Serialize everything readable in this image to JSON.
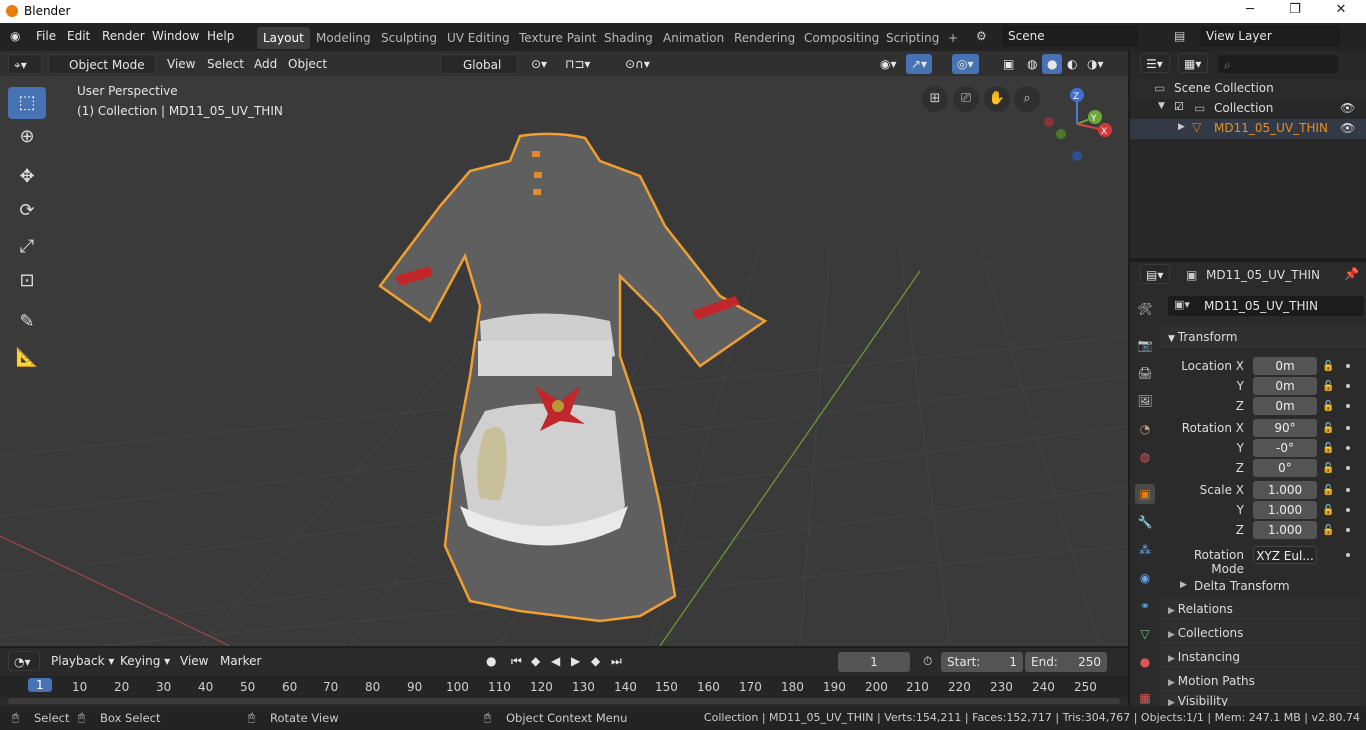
{
  "window": {
    "title": "Blender",
    "minimize": "─",
    "maximize": "❐",
    "close": "✕"
  },
  "menu": [
    "File",
    "Edit",
    "Render",
    "Window",
    "Help"
  ],
  "workspaces": [
    "Layout",
    "Modeling",
    "Sculpting",
    "UV Editing",
    "Texture Paint",
    "Shading",
    "Animation",
    "Rendering",
    "Compositing",
    "Scripting"
  ],
  "add_workspace": "+",
  "scene": "Scene",
  "view_layer": "View Layer",
  "viewport_header": {
    "mode": "Object Mode",
    "view": "View",
    "select": "Select",
    "add": "Add",
    "object": "Object",
    "orientation": "Global"
  },
  "viewport": {
    "perspective": "User Perspective",
    "collection_info": "(1) Collection | MD11_05_UV_THIN",
    "gizmo": {
      "z": "Z",
      "y": "Y",
      "x": "X"
    }
  },
  "outliner": {
    "scene_collection": "Scene Collection",
    "collection": "Collection",
    "object": "MD11_05_UV_THIN",
    "search_placeholder": ""
  },
  "properties": {
    "object_name": "MD11_05_UV_THIN",
    "datablock": "MD11_05_UV_THIN",
    "transform_title": "Transform",
    "location": {
      "label": "Location X",
      "x": "0m",
      "y": "0m",
      "z": "0m"
    },
    "rotation": {
      "label": "Rotation X",
      "x": "90°",
      "y": "-0°",
      "z": "0°"
    },
    "scale": {
      "label": "Scale X",
      "x": "1.000",
      "y": "1.000",
      "z": "1.000"
    },
    "axis_y": "Y",
    "axis_z": "Z",
    "rotation_mode_label": "Rotation Mode",
    "rotation_mode": "XYZ Eul...",
    "delta": "Delta Transform",
    "panels": [
      "Relations",
      "Collections",
      "Instancing",
      "Motion Paths",
      "Visibility"
    ]
  },
  "timeline": {
    "playback": "Playback",
    "keying": "Keying",
    "view": "View",
    "marker": "Marker",
    "current_frame": "1",
    "start_label": "Start:",
    "start": "1",
    "end_label": "End:",
    "end": "250",
    "frames": [
      "1",
      "10",
      "20",
      "30",
      "40",
      "50",
      "60",
      "70",
      "80",
      "90",
      "100",
      "110",
      "120",
      "130",
      "140",
      "150",
      "160",
      "170",
      "180",
      "190",
      "200",
      "210",
      "220",
      "230",
      "240",
      "250"
    ]
  },
  "statusbar": {
    "select": "Select",
    "box_select": "Box Select",
    "rotate_view": "Rotate View",
    "context_menu": "Object Context Menu",
    "stats": "Collection | MD11_05_UV_THIN | Verts:154,211 | Faces:152,717 | Tris:304,767 | Objects:1/1 | Mem: 247.1 MB | v2.80.74"
  },
  "colors": {
    "accent": "#4772b3",
    "selected": "#e87d0d",
    "header": "#303030",
    "viewport": "#3a3a3a"
  }
}
